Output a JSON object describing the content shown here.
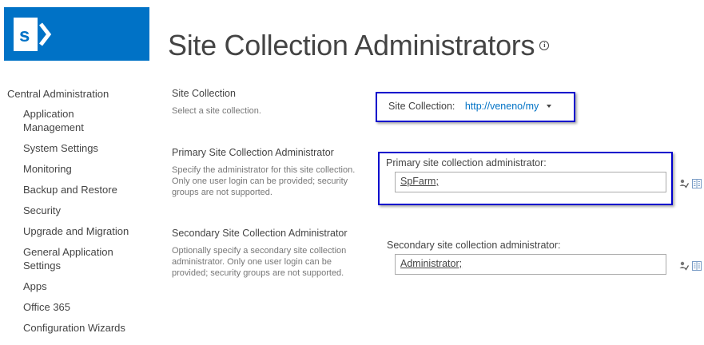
{
  "page": {
    "title": "Site Collection Administrators"
  },
  "nav": {
    "root": "Central Administration",
    "items": [
      "Application Management",
      "System Settings",
      "Monitoring",
      "Backup and Restore",
      "Security",
      "Upgrade and Migration",
      "General Application Settings",
      "Apps",
      "Office 365",
      "Configuration Wizards"
    ]
  },
  "sections": {
    "site_collection": {
      "title": "Site Collection",
      "description": "Select a site collection.",
      "field_label": "Site Collection:",
      "value": "http://veneno/my"
    },
    "primary": {
      "title": "Primary Site Collection Administrator",
      "description": "Specify the administrator for this site collection. Only one user login can be provided; security groups are not supported.",
      "field_label": "Primary site collection administrator:",
      "value": "SpFarm;"
    },
    "secondary": {
      "title": "Secondary Site Collection Administrator",
      "description": "Optionally specify a secondary site collection administrator. Only one user login can be provided; security groups are not supported.",
      "field_label": "Secondary site collection administrator:",
      "value": "Administrator;"
    }
  },
  "colors": {
    "brand": "#0072c6",
    "highlight": "#0000cc"
  },
  "icons": {
    "logo": "sharepoint-logo",
    "info": "info-icon",
    "check_names": "check-names-icon",
    "browse": "browse-address-book-icon"
  }
}
